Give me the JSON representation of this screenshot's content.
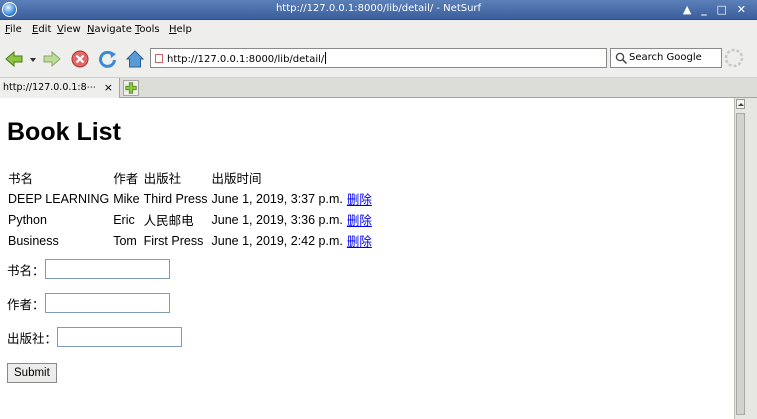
{
  "window": {
    "title": "http://127.0.0.1:8000/lib/detail/ - NetSurf",
    "controls": [
      "▲",
      "_",
      "□",
      "✕"
    ]
  },
  "menu": {
    "items": [
      {
        "label": "File",
        "underline": "F",
        "rest": "ile"
      },
      {
        "label": "Edit",
        "underline": "E",
        "rest": "dit"
      },
      {
        "label": "View",
        "underline": "V",
        "rest": "iew"
      },
      {
        "label": "Navigate",
        "underline": "N",
        "rest": "avigate"
      },
      {
        "label": "Tools",
        "underline": "T",
        "rest": "ools"
      },
      {
        "label": "Help",
        "underline": "H",
        "rest": "elp"
      }
    ]
  },
  "toolbar": {
    "url": "http://127.0.0.1:8000/lib/detail/",
    "search_placeholder": "Search Google",
    "back_icon": "back-arrow-icon",
    "forward_icon": "forward-arrow-icon",
    "stop_icon": "stop-icon",
    "reload_icon": "reload-icon",
    "home_icon": "home-icon"
  },
  "tabs": [
    {
      "label": "http://127.0.0.1:8⋯",
      "close": "×"
    }
  ],
  "page": {
    "title": "Book List",
    "table": {
      "headers": [
        "书名",
        "作者",
        "出版社",
        "出版时间"
      ],
      "rows": [
        {
          "title": "DEEP LEARNING",
          "author": "Mike",
          "publisher": "Third Press",
          "date": "June 1, 2019, 3:37 p.m.",
          "action": "删除"
        },
        {
          "title": "Python",
          "author": "Eric",
          "publisher": "人民邮电",
          "date": "June 1, 2019, 3:36 p.m.",
          "action": "删除"
        },
        {
          "title": "Business",
          "author": "Tom",
          "publisher": "First Press",
          "date": "June 1, 2019, 2:42 p.m.",
          "action": "删除"
        }
      ]
    },
    "form": {
      "title_label": "书名：",
      "author_label": "作者：",
      "publisher_label": "出版社：",
      "title_value": "",
      "author_value": "",
      "publisher_value": "",
      "submit_label": "Submit"
    }
  },
  "colors": {
    "titlebar": "#3a5f9c",
    "link": "#0000ee",
    "chrome": "#eeeeec"
  }
}
